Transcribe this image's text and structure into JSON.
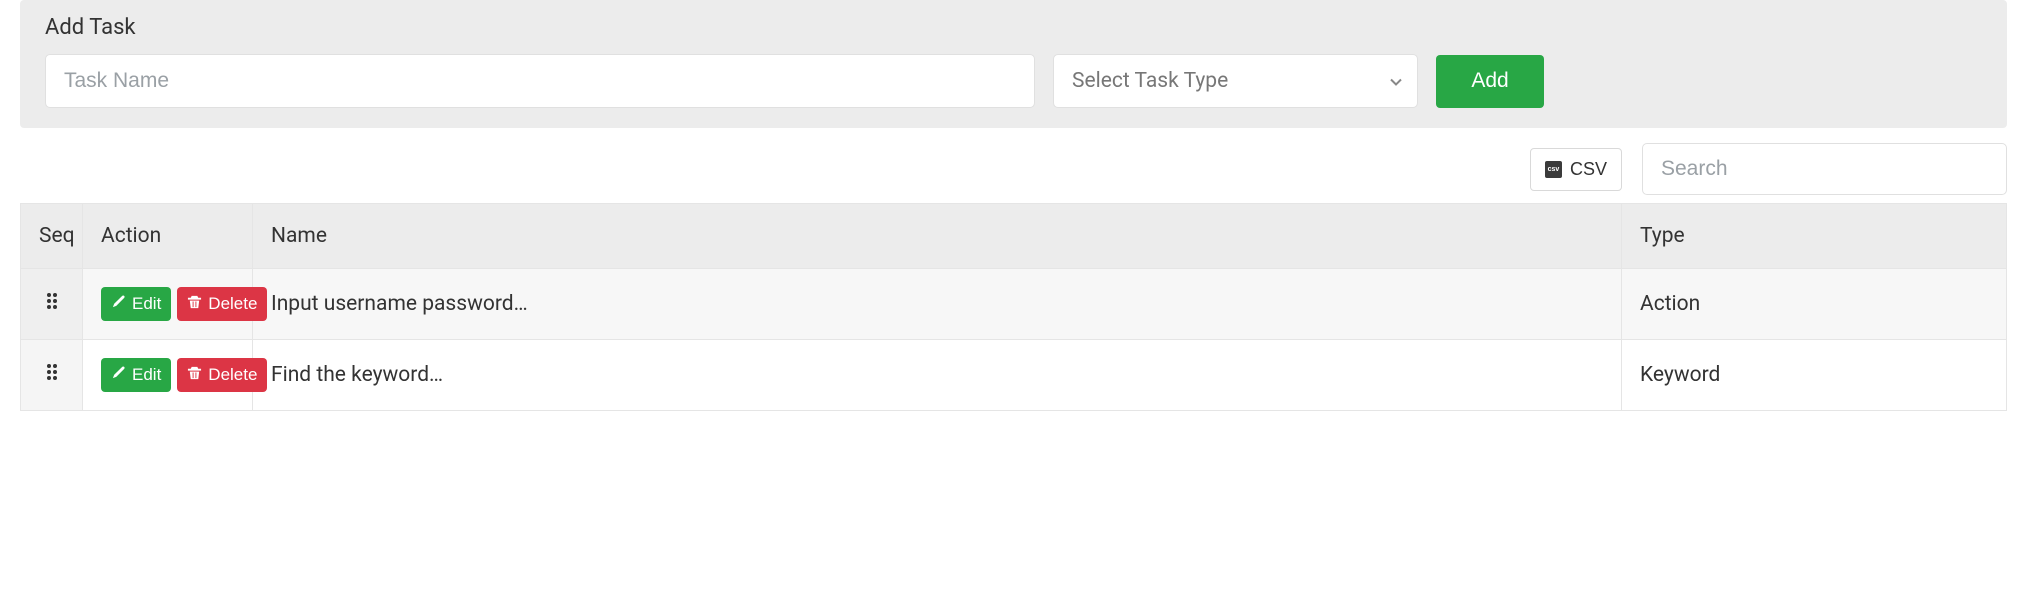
{
  "panel": {
    "title": "Add Task",
    "task_name_placeholder": "Task Name",
    "select_placeholder": "Select Task Type",
    "add_label": "Add"
  },
  "toolbar": {
    "csv_label": "CSV",
    "search_placeholder": "Search"
  },
  "table": {
    "headers": {
      "seq": "Seq",
      "action": "Action",
      "name": "Name",
      "type": "Type"
    },
    "buttons": {
      "edit": "Edit",
      "delete": "Delete"
    },
    "rows": [
      {
        "name": "Input username password…",
        "type": "Action"
      },
      {
        "name": "Find the keyword…",
        "type": "Keyword"
      }
    ]
  }
}
